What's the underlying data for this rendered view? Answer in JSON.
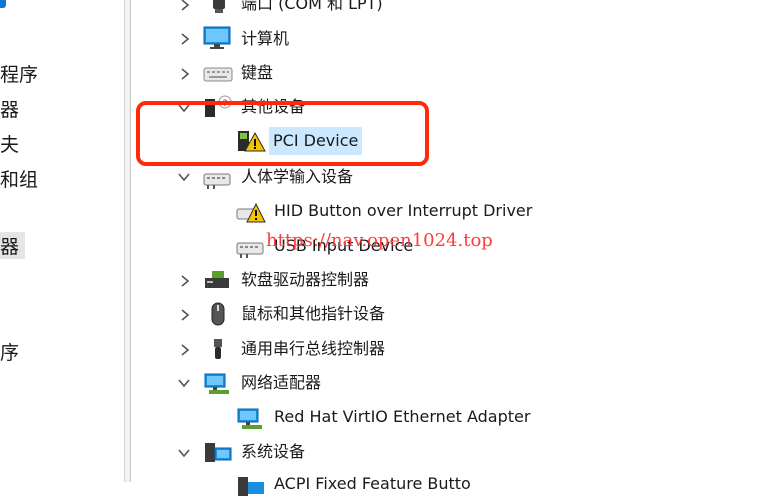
{
  "left_nav": {
    "items": [
      {
        "label": "程序"
      },
      {
        "label": "器"
      },
      {
        "label": "夫"
      },
      {
        "label": "和组"
      },
      {
        "label": "器"
      },
      {
        "label": "序"
      }
    ]
  },
  "tree": {
    "ports": {
      "label": "端口 (COM 和 LPT)",
      "icon": "port-icon"
    },
    "computer": {
      "label": "计算机",
      "icon": "monitor-icon"
    },
    "keyboard": {
      "label": "键盘",
      "icon": "keyboard-icon"
    },
    "other_devices": {
      "label": "其他设备",
      "icon": "unknown-device-icon",
      "children": [
        {
          "label": "PCI Device",
          "icon": "warning-device-icon"
        }
      ]
    },
    "hid": {
      "label": "人体学输入设备",
      "icon": "hid-icon",
      "children": [
        {
          "label": "HID Button over Interrupt Driver",
          "icon": "warning-hid-icon"
        },
        {
          "label": "USB Input Device",
          "icon": "hid-device-icon"
        }
      ]
    },
    "floppy": {
      "label": "软盘驱动器控制器",
      "icon": "floppy-controller-icon"
    },
    "mouse": {
      "label": "鼠标和其他指针设备",
      "icon": "mouse-icon"
    },
    "usb": {
      "label": "通用串行总线控制器",
      "icon": "usb-icon"
    },
    "network": {
      "label": "网络适配器",
      "icon": "network-icon",
      "children": [
        {
          "label": "Red Hat VirtIO Ethernet Adapter",
          "icon": "network-adapter-icon"
        }
      ]
    },
    "system": {
      "label": "系统设备",
      "icon": "system-icon",
      "children": [
        {
          "label": "ACPI Fixed Feature Butto",
          "icon": "system-device-icon"
        }
      ]
    }
  },
  "watermark": "https://nav.open1024.top",
  "colors": {
    "highlight": "#ff2a0a",
    "selection": "#cce8ff",
    "watermark": "#ff3b3b",
    "warning": "#f4c400"
  }
}
